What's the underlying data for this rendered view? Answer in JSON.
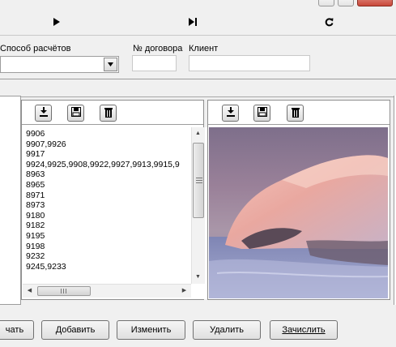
{
  "toolbar": {
    "play_icon": "play-icon",
    "skip_end_icon": "skip-to-end-icon",
    "refresh_icon": "refresh-icon"
  },
  "form": {
    "payment_method_label": "Способ расчётов",
    "payment_method_value": "",
    "contract_no_label": "№ договора",
    "contract_no_value": "",
    "client_label": "Клиент",
    "client_value": ""
  },
  "left_panel": {
    "toolbar_icons": [
      "download-icon",
      "save-icon",
      "delete-icon"
    ],
    "items": [
      "9906",
      "9907,9926",
      "9917",
      "9924,9925,9908,9922,9927,9913,9915,9",
      "8963",
      "8965",
      "8971",
      "8973",
      "9180",
      "9182",
      "9195",
      "9198",
      "9232",
      "9245,9233"
    ]
  },
  "right_panel": {
    "toolbar_icons": [
      "download-icon",
      "save-icon",
      "delete-icon"
    ]
  },
  "buttons": {
    "print": "чать",
    "add": "Добавить",
    "edit": "Изменить",
    "delete": "Удалить",
    "credit": "Зачислить"
  },
  "colors": {
    "window_bg": "#f0f0f0",
    "panel_border": "#8e8e8e",
    "photo_sky_top": "#7e6f8b",
    "photo_glow": "#e9a8a0"
  }
}
